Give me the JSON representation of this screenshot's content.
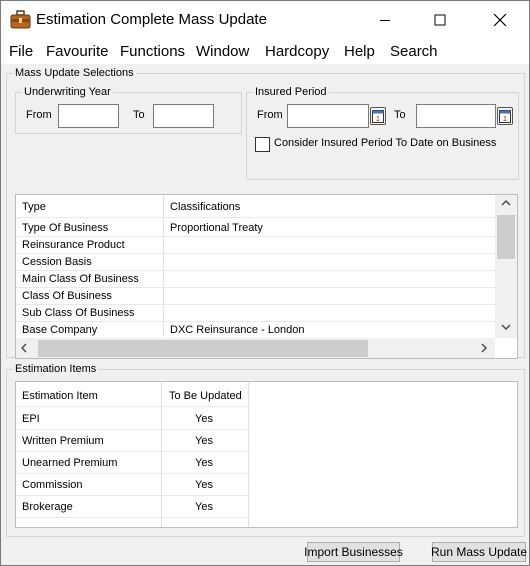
{
  "window": {
    "title": "Estimation Complete Mass Update",
    "controls": [
      "minimize",
      "maximize",
      "close"
    ]
  },
  "menu": [
    "File",
    "Favourite",
    "Functions",
    "Window",
    "Hardcopy",
    "Help",
    "Search"
  ],
  "mass_update": {
    "legend": "Mass Update Selections",
    "underwriting_year": {
      "legend": "Underwriting Year",
      "from_label": "From",
      "to_label": "To",
      "from_value": "",
      "to_value": ""
    },
    "insured_period": {
      "legend": "Insured Period",
      "from_label": "From",
      "to_label": "To",
      "from_value": "",
      "to_value": "",
      "consider_label": "Consider Insured Period To Date on Business",
      "consider_checked": false
    }
  },
  "type_grid": {
    "headers": [
      "Type",
      "Classifications"
    ],
    "rows": [
      [
        "Type Of Business",
        "Proportional Treaty"
      ],
      [
        "Reinsurance Product",
        ""
      ],
      [
        "Cession Basis",
        ""
      ],
      [
        "Main Class Of Business",
        ""
      ],
      [
        "Class Of Business",
        ""
      ],
      [
        "Sub Class Of Business",
        ""
      ],
      [
        "Base Company",
        "DXC Reinsurance - London"
      ]
    ]
  },
  "estimation_items": {
    "legend": "Estimation Items",
    "headers": [
      "Estimation Item",
      "To Be Updated"
    ],
    "rows": [
      [
        "EPI",
        "Yes"
      ],
      [
        "Written Premium",
        "Yes"
      ],
      [
        "Unearned Premium",
        "Yes"
      ],
      [
        "Commission",
        "Yes"
      ],
      [
        "Brokerage",
        "Yes"
      ]
    ]
  },
  "buttons": {
    "import": "Import Businesses",
    "run": "Run Mass Update"
  }
}
